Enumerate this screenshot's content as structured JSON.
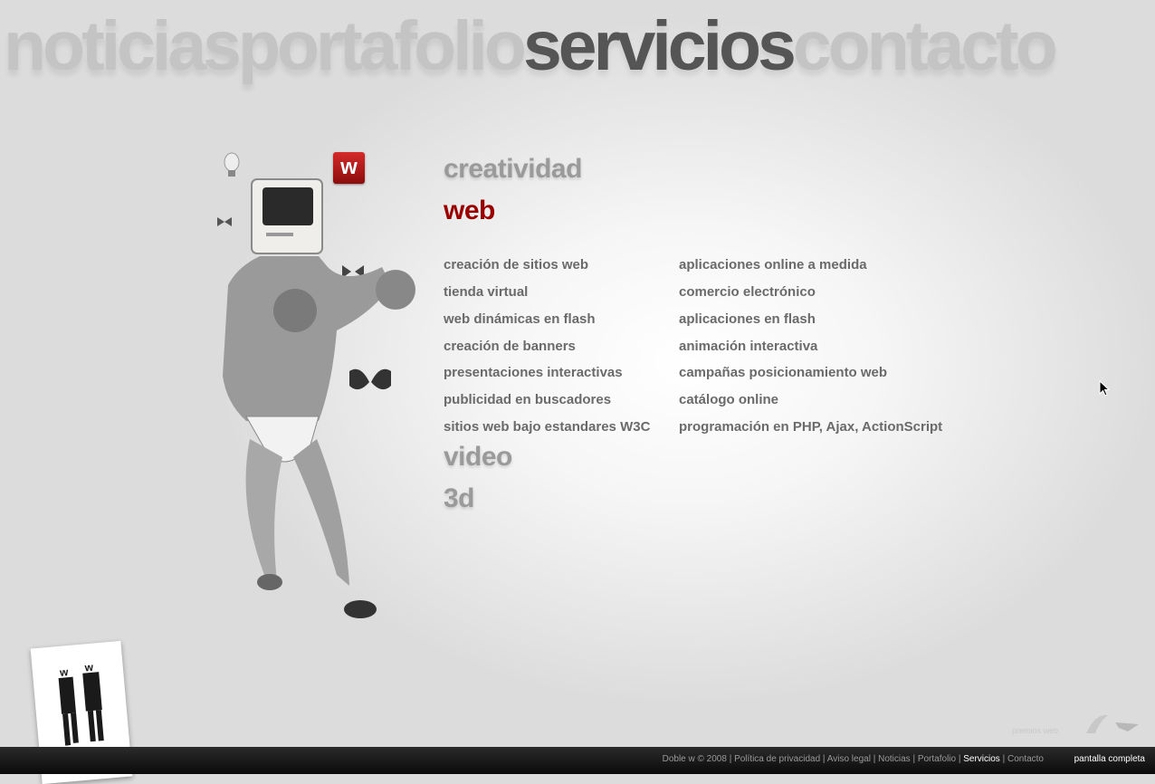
{
  "topnav": {
    "items": [
      {
        "label": "noticias"
      },
      {
        "label": "portafolio"
      },
      {
        "label": "servicios"
      },
      {
        "label": "contacto"
      }
    ]
  },
  "logo": {
    "letter": "w",
    "color": "#cc1f1f"
  },
  "categories": {
    "creatividad": "creatividad",
    "web": "web",
    "video": "video",
    "3d": "3d"
  },
  "services": {
    "left": [
      "creación de sitios web",
      "tienda virtual",
      "web dinámicas en flash",
      "creación de banners",
      "presentaciones interactivas",
      "publicidad en buscadores",
      "sitios web bajo estandares W3C"
    ],
    "right": [
      "aplicaciones online a medida",
      "comercio electrónico",
      "aplicaciones en flash",
      "animación interactiva",
      "campañas posicionamiento web",
      "catálogo online",
      "programación en PHP, Ajax, ActionScript"
    ]
  },
  "awards_label": "premios web",
  "footer": {
    "copyright": "Doble w © 2008",
    "privacy": "Política de privacidad",
    "legal": "Aviso legal",
    "noticias": "Noticias",
    "portafolio": "Portafolio",
    "servicios": "Servicios",
    "contacto": "Contacto",
    "separator": " | ",
    "fullscreen": "pantalla completa"
  },
  "colors": {
    "accent": "#990000",
    "nav_inactive": "#c4c4c4",
    "nav_active": "#555555"
  }
}
